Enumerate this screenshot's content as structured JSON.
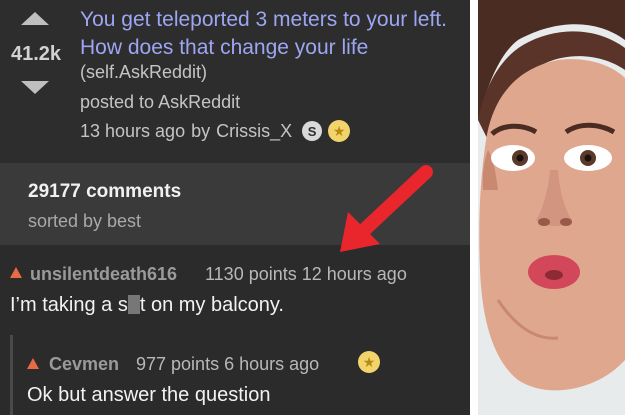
{
  "post": {
    "score": "41.2k",
    "title": "You get teleported 3 meters to your left. How does that change your life",
    "domain": "(self.AskReddit)",
    "posted_to": "posted to AskReddit",
    "time": "13 hours ago",
    "by": "by",
    "author": "Crissis_X",
    "badge_letter": "S"
  },
  "comments_header": {
    "count": "29177 comments",
    "sorted": "sorted by best"
  },
  "comments": [
    {
      "author": "unsilentdeath616",
      "points": "1130 points 12 hours ago",
      "body_before": "I’m taking a s",
      "body_after": "t on my balcony."
    },
    {
      "author": "Cevmen",
      "points": "977 points 6 hours ago",
      "body": "Ok but answer the question"
    }
  ],
  "colors": {
    "title": "#9da6f2",
    "upvote": "#e66a44",
    "arrow": "#e8262b",
    "gold": "#f3d36b"
  },
  "icons": [
    "upvote-arrow-icon",
    "downvote-arrow-icon",
    "star-badge-icon",
    "annotation-arrow-icon"
  ]
}
